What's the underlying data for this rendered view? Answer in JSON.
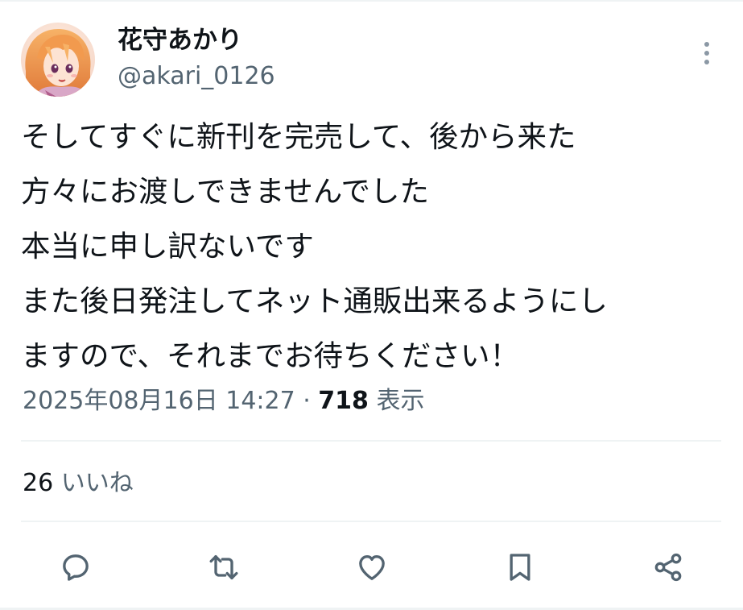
{
  "author": {
    "display_name": "花守あかり",
    "handle": "@akari_0126",
    "avatar_icon": "anime-girl-avatar-icon"
  },
  "tweet": {
    "text_lines": [
      "そしてすぐに新刊を完売して、後から来た",
      "方々にお渡しできませんでした",
      "本当に申し訳ないです",
      "また後日発注してネット通販出来るようにし",
      "ますので、それまでお待ちください！"
    ],
    "timestamp": "2025年08月16日 14:27",
    "separator": " · ",
    "views_count": "718",
    "views_label": " 表示"
  },
  "engagement": {
    "likes_count": "26",
    "likes_label": " いいね"
  },
  "actions": [
    {
      "name": "reply",
      "icon": "reply-icon"
    },
    {
      "name": "retweet",
      "icon": "retweet-icon"
    },
    {
      "name": "like",
      "icon": "heart-icon"
    },
    {
      "name": "bookmark",
      "icon": "bookmark-icon"
    },
    {
      "name": "share",
      "icon": "share-icon"
    }
  ],
  "colors": {
    "text_primary": "#0f1419",
    "text_secondary": "#536471",
    "divider": "#eff3f4",
    "icon": "#536471"
  }
}
